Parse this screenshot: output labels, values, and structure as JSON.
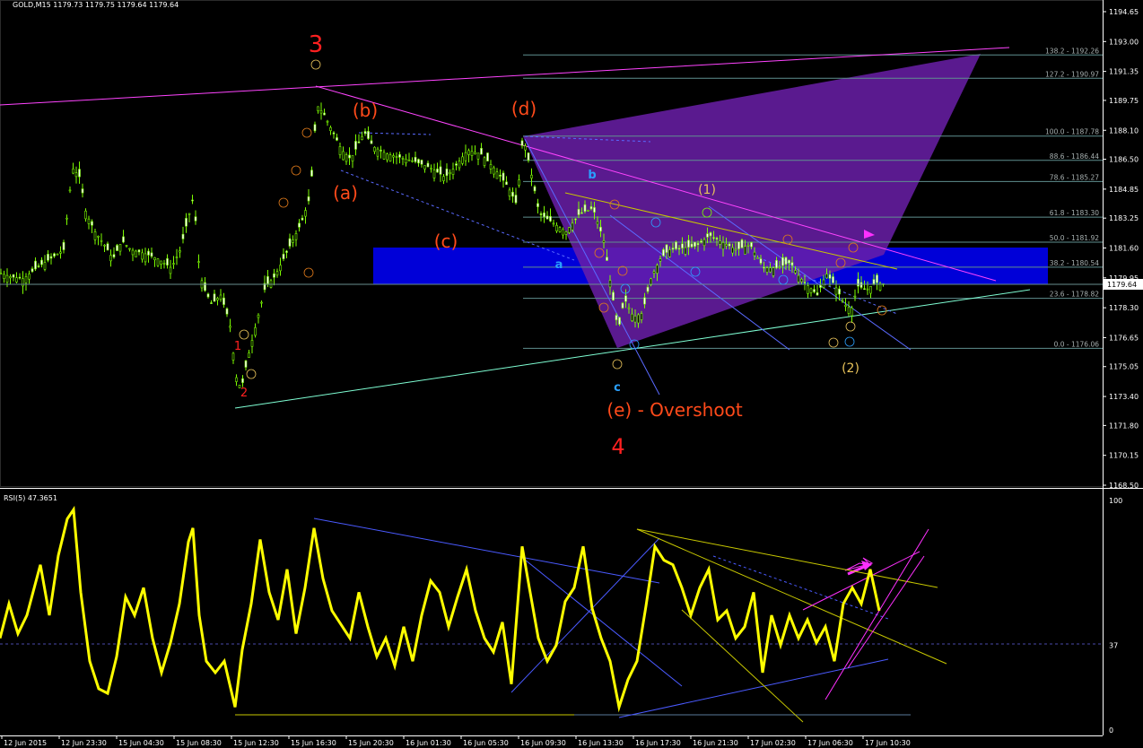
{
  "header": {
    "symbol_line": "GOLD,M15  1179.73 1179.75 1179.64 1179.64",
    "current_price": "1179.64"
  },
  "rsi": {
    "label": "RSI(5) 47.3651",
    "axis_labels": [
      "100",
      "37",
      "0"
    ]
  },
  "chart_data": [
    {
      "type": "candlestick",
      "title": "GOLD,M15",
      "ylim": [
        1168.0,
        1196.0
      ],
      "price_tick_labels": [
        "1194.65",
        "1193.00",
        "1191.35",
        "1189.75",
        "1188.10",
        "1186.50",
        "1184.85",
        "1183.25",
        "1181.60",
        "1179.95",
        "1178.30",
        "1176.65",
        "1175.05",
        "1173.40",
        "1171.80",
        "1170.15",
        "1168.50"
      ],
      "x_tick_labels": [
        "12 Jun 2015",
        "12 Jun 23:30",
        "15 Jun 04:30",
        "15 Jun 08:30",
        "15 Jun 12:30",
        "15 Jun 16:30",
        "15 Jun 20:30",
        "16 Jun 01:30",
        "16 Jun 05:30",
        "16 Jun 09:30",
        "16 Jun 13:30",
        "16 Jun 17:30",
        "16 Jun 21:30",
        "17 Jun 02:30",
        "17 Jun 06:30",
        "17 Jun 10:30"
      ],
      "close_path": [
        [
          0,
          1180.2
        ],
        [
          12,
          1180.0
        ],
        [
          25,
          1179.9
        ],
        [
          40,
          1180.5
        ],
        [
          55,
          1181.0
        ],
        [
          70,
          1181.5
        ],
        [
          75,
          1184.0
        ],
        [
          80,
          1186.0
        ],
        [
          88,
          1185.5
        ],
        [
          95,
          1183.5
        ],
        [
          105,
          1182.5
        ],
        [
          115,
          1181.8
        ],
        [
          125,
          1181.0
        ],
        [
          135,
          1182.0
        ],
        [
          145,
          1181.5
        ],
        [
          160,
          1181.3
        ],
        [
          175,
          1181.0
        ],
        [
          190,
          1180.5
        ],
        [
          200,
          1181.5
        ],
        [
          210,
          1183.5
        ],
        [
          215,
          1184.5
        ],
        [
          220,
          1181.0
        ],
        [
          225,
          1179.5
        ],
        [
          235,
          1178.5
        ],
        [
          245,
          1179.0
        ],
        [
          255,
          1177.5
        ],
        [
          262,
          1174.5
        ],
        [
          268,
          1173.8
        ],
        [
          275,
          1175.5
        ],
        [
          285,
          1177.5
        ],
        [
          295,
          1179.5
        ],
        [
          305,
          1180.0
        ],
        [
          315,
          1181.0
        ],
        [
          325,
          1182.0
        ],
        [
          335,
          1183.0
        ],
        [
          345,
          1184.5
        ],
        [
          352,
          1189.5
        ],
        [
          360,
          1189.0
        ],
        [
          370,
          1188.0
        ],
        [
          380,
          1187.0
        ],
        [
          390,
          1186.5
        ],
        [
          405,
          1188.0
        ],
        [
          415,
          1187.2
        ],
        [
          430,
          1186.8
        ],
        [
          445,
          1186.6
        ],
        [
          460,
          1186.4
        ],
        [
          480,
          1186.0
        ],
        [
          495,
          1185.5
        ],
        [
          505,
          1186.0
        ],
        [
          520,
          1187.0
        ],
        [
          535,
          1186.8
        ],
        [
          550,
          1186.0
        ],
        [
          565,
          1185.0
        ],
        [
          575,
          1184.0
        ],
        [
          582,
          1187.8
        ],
        [
          590,
          1186.0
        ],
        [
          600,
          1183.5
        ],
        [
          615,
          1183.0
        ],
        [
          630,
          1182.5
        ],
        [
          645,
          1183.5
        ],
        [
          660,
          1183.8
        ],
        [
          672,
          1182.0
        ],
        [
          680,
          1179.5
        ],
        [
          688,
          1177.0
        ],
        [
          695,
          1178.8
        ],
        [
          705,
          1177.8
        ],
        [
          715,
          1178.0
        ],
        [
          725,
          1180.0
        ],
        [
          735,
          1181.0
        ],
        [
          745,
          1181.5
        ],
        [
          760,
          1181.6
        ],
        [
          775,
          1181.7
        ],
        [
          790,
          1182.3
        ],
        [
          805,
          1181.9
        ],
        [
          820,
          1181.5
        ],
        [
          835,
          1181.8
        ],
        [
          850,
          1180.5
        ],
        [
          865,
          1180.5
        ],
        [
          880,
          1180.8
        ],
        [
          890,
          1180.0
        ],
        [
          900,
          1179.5
        ],
        [
          910,
          1179.0
        ],
        [
          920,
          1180.2
        ],
        [
          930,
          1179.5
        ],
        [
          940,
          1178.5
        ],
        [
          948,
          1178.2
        ],
        [
          955,
          1179.5
        ],
        [
          965,
          1179.3
        ],
        [
          975,
          1179.7
        ],
        [
          985,
          1179.6
        ]
      ],
      "fib_levels": [
        {
          "label": "138.2 - 1192.26",
          "price": 1192.26
        },
        {
          "label": "127.2 - 1190.97",
          "price": 1190.97
        },
        {
          "label": "100.0 - 1187.78",
          "price": 1187.78
        },
        {
          "label": "88.6 - 1186.44",
          "price": 1186.44
        },
        {
          "label": "78.6 - 1185.27",
          "price": 1185.27
        },
        {
          "label": "61.8 - 1183.30",
          "price": 1183.3
        },
        {
          "label": "50.0 - 1181.92",
          "price": 1181.92
        },
        {
          "label": "38.2 - 1180.54",
          "price": 1180.54
        },
        {
          "label": "23.6 - 1178.82",
          "price": 1178.82
        },
        {
          "label": "0.0 - 1176.06",
          "price": 1176.06
        }
      ],
      "wave_labels": [
        {
          "text": "3",
          "color": "#ff2020",
          "size": "big"
        },
        {
          "text": "4",
          "color": "#ff2020",
          "size": "big"
        },
        {
          "text": "(a)",
          "color": "#ff4a1a",
          "size": "med"
        },
        {
          "text": "(b)",
          "color": "#ff4a1a",
          "size": "med"
        },
        {
          "text": "(c)",
          "color": "#ff4a1a",
          "size": "med"
        },
        {
          "text": "(d)",
          "color": "#ff4a1a",
          "size": "med"
        },
        {
          "text": "(e) - Overshoot",
          "color": "#ff4a1a",
          "size": "med"
        },
        {
          "text": "(1)",
          "color": "#e8c35a",
          "size": "sml"
        },
        {
          "text": "(2)",
          "color": "#e8c35a",
          "size": "sml"
        },
        {
          "text": "a",
          "color": "#2aa0ff",
          "size": "sml"
        },
        {
          "text": "b",
          "color": "#2aa0ff",
          "size": "sml"
        },
        {
          "text": "c",
          "color": "#2aa0ff",
          "size": "sml"
        },
        {
          "text": "1",
          "color": "#ff2020",
          "size": "sml"
        },
        {
          "text": "2",
          "color": "#ff2020",
          "size": "sml"
        }
      ]
    },
    {
      "type": "line",
      "title": "RSI(5) 47.3651",
      "ylim": [
        0,
        100
      ],
      "level_line": 37,
      "series": [
        {
          "name": "RSI(5)",
          "color": "#ffff00",
          "points": [
            [
              0,
              40
            ],
            [
              10,
              55
            ],
            [
              20,
              42
            ],
            [
              30,
              50
            ],
            [
              45,
              72
            ],
            [
              55,
              50
            ],
            [
              65,
              76
            ],
            [
              75,
              92
            ],
            [
              82,
              96
            ],
            [
              90,
              60
            ],
            [
              100,
              30
            ],
            [
              110,
              18
            ],
            [
              120,
              16
            ],
            [
              130,
              32
            ],
            [
              140,
              58
            ],
            [
              150,
              50
            ],
            [
              160,
              62
            ],
            [
              170,
              40
            ],
            [
              180,
              25
            ],
            [
              190,
              38
            ],
            [
              200,
              55
            ],
            [
              210,
              82
            ],
            [
              215,
              88
            ],
            [
              222,
              50
            ],
            [
              230,
              30
            ],
            [
              240,
              25
            ],
            [
              250,
              30
            ],
            [
              262,
              10
            ],
            [
              270,
              35
            ],
            [
              280,
              55
            ],
            [
              290,
              83
            ],
            [
              300,
              60
            ],
            [
              310,
              48
            ],
            [
              320,
              70
            ],
            [
              330,
              42
            ],
            [
              340,
              62
            ],
            [
              350,
              88
            ],
            [
              360,
              66
            ],
            [
              370,
              52
            ],
            [
              380,
              46
            ],
            [
              390,
              40
            ],
            [
              400,
              60
            ],
            [
              410,
              45
            ],
            [
              420,
              32
            ],
            [
              430,
              40
            ],
            [
              440,
              28
            ],
            [
              450,
              45
            ],
            [
              460,
              30
            ],
            [
              470,
              50
            ],
            [
              480,
              65
            ],
            [
              490,
              60
            ],
            [
              500,
              45
            ],
            [
              510,
              58
            ],
            [
              520,
              70
            ],
            [
              530,
              52
            ],
            [
              540,
              40
            ],
            [
              550,
              34
            ],
            [
              560,
              47
            ],
            [
              570,
              20
            ],
            [
              582,
              80
            ],
            [
              590,
              62
            ],
            [
              600,
              40
            ],
            [
              610,
              30
            ],
            [
              620,
              37
            ],
            [
              630,
              56
            ],
            [
              640,
              62
            ],
            [
              650,
              80
            ],
            [
              660,
              53
            ],
            [
              670,
              40
            ],
            [
              680,
              30
            ],
            [
              690,
              10
            ],
            [
              700,
              22
            ],
            [
              710,
              30
            ],
            [
              720,
              54
            ],
            [
              730,
              80
            ],
            [
              740,
              74
            ],
            [
              750,
              72
            ],
            [
              760,
              62
            ],
            [
              770,
              50
            ],
            [
              780,
              62
            ],
            [
              790,
              70
            ],
            [
              800,
              48
            ],
            [
              810,
              52
            ],
            [
              820,
              40
            ],
            [
              830,
              45
            ],
            [
              840,
              60
            ],
            [
              850,
              25
            ],
            [
              860,
              50
            ],
            [
              870,
              37
            ],
            [
              880,
              50
            ],
            [
              890,
              40
            ],
            [
              900,
              48
            ],
            [
              910,
              38
            ],
            [
              920,
              45
            ],
            [
              930,
              30
            ],
            [
              940,
              55
            ],
            [
              950,
              62
            ],
            [
              960,
              55
            ],
            [
              970,
              70
            ],
            [
              980,
              52
            ]
          ]
        }
      ]
    }
  ]
}
